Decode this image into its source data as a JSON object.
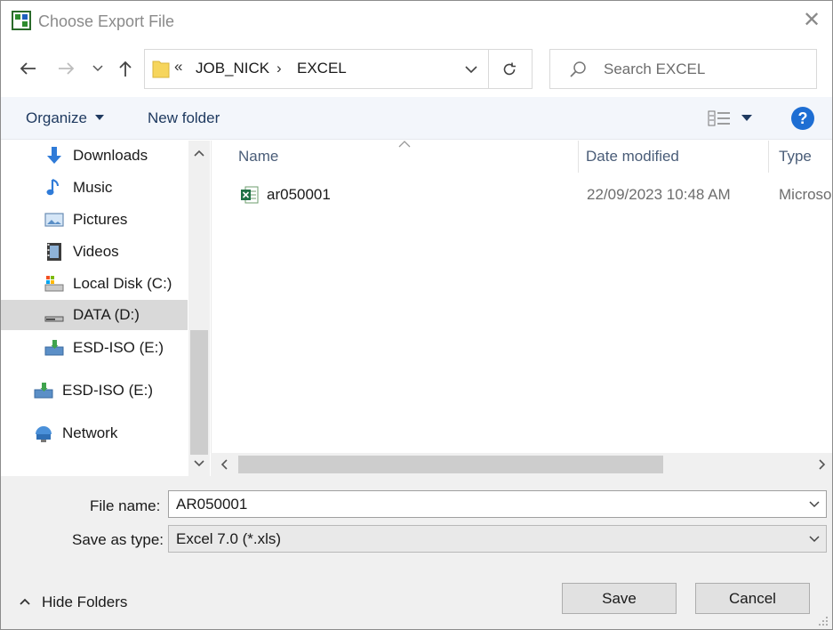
{
  "window": {
    "title": "Choose Export File"
  },
  "address": {
    "overflow": "«",
    "segments": [
      "JOB_NICK",
      "EXCEL"
    ],
    "separator": "›"
  },
  "search": {
    "placeholder": "Search EXCEL"
  },
  "toolbar": {
    "organize": "Organize",
    "new_folder": "New folder",
    "help": "?"
  },
  "sidebar": {
    "items": [
      {
        "label": "Downloads",
        "icon": "downloads-icon"
      },
      {
        "label": "Music",
        "icon": "music-icon"
      },
      {
        "label": "Pictures",
        "icon": "pictures-icon"
      },
      {
        "label": "Videos",
        "icon": "videos-icon"
      },
      {
        "label": "Local Disk (C:)",
        "icon": "local-disk-icon"
      },
      {
        "label": "DATA (D:)",
        "icon": "drive-icon",
        "selected": true
      },
      {
        "label": "ESD-ISO (E:)",
        "icon": "usb-drive-icon"
      },
      {
        "label": "ESD-ISO (E:)",
        "icon": "usb-drive-icon"
      },
      {
        "label": "Network",
        "icon": "network-icon"
      }
    ]
  },
  "file_list": {
    "columns": [
      "Name",
      "Date modified",
      "Type"
    ],
    "rows": [
      {
        "name": "ar050001",
        "date_modified": "22/09/2023 10:48 AM",
        "type": "Microso",
        "icon": "excel-file-icon"
      }
    ]
  },
  "form": {
    "file_name_label": "File name:",
    "file_name_value": "AR050001",
    "save_type_label": "Save as type:",
    "save_type_value": "Excel 7.0 (*.xls)"
  },
  "buttons": {
    "hide_folders": "Hide Folders",
    "save": "Save",
    "cancel": "Cancel"
  },
  "colors": {
    "accent": "#1e6ed3",
    "selected_bg": "#d9d9d9",
    "toolbar_bg": "#f3f6fb"
  }
}
